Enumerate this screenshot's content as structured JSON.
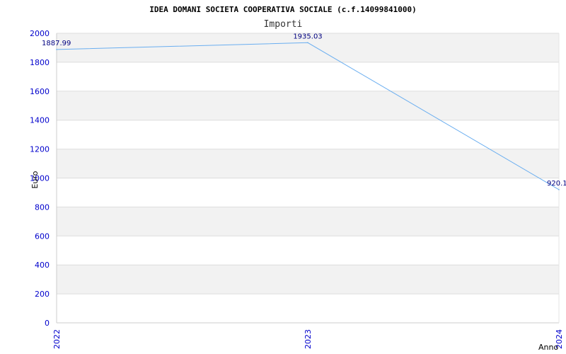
{
  "chart_data": {
    "type": "line",
    "title": "IDEA DOMANI SOCIETA COOPERATIVA SOCIALE (c.f.14099841000)",
    "subtitle": "Importi",
    "xlabel": "Anno",
    "ylabel": "Euro",
    "categories": [
      "2022",
      "2023",
      "2024"
    ],
    "values": [
      1887.99,
      1935.03,
      920.1
    ],
    "data_labels": [
      "1887.99",
      "1935.03",
      "920.1"
    ],
    "ylim": [
      0,
      2000
    ],
    "yticks": [
      "0",
      "200",
      "400",
      "600",
      "800",
      "1000",
      "1200",
      "1400",
      "1600",
      "1800",
      "2000"
    ],
    "grid": true,
    "line_color": "#6aaef0",
    "label_color": "#000080",
    "tick_color": "#0000cc",
    "band_color": "#f2f2f2"
  }
}
